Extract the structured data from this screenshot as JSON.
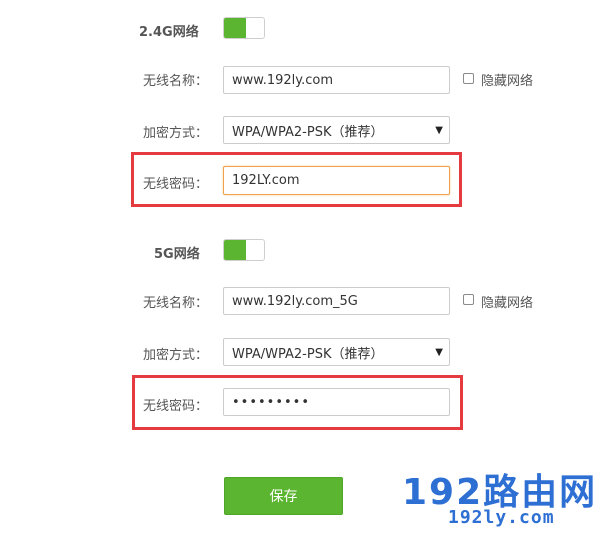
{
  "wifi_24": {
    "title": "2.4G网络",
    "ssid_label": "无线名称：",
    "ssid_value": "www.192ly.com",
    "hide_label": "隐藏网络",
    "encryption_label": "加密方式：",
    "encryption_value": "WPA/WPA2-PSK（推荐）",
    "password_label": "无线密码：",
    "password_value": "192LY.com",
    "enabled": true
  },
  "wifi_5": {
    "title": "5G网络",
    "ssid_label": "无线名称：",
    "ssid_value": "www.192ly.com_5G",
    "hide_label": "隐藏网络",
    "encryption_label": "加密方式：",
    "encryption_value": "WPA/WPA2-PSK（推荐）",
    "password_label": "无线密码：",
    "password_value": "•••••••••",
    "enabled": true
  },
  "save_label": "保存",
  "watermark": {
    "big": "192路由网",
    "small": "192ly.com"
  },
  "colors": {
    "accent_green": "#5cb531",
    "highlight_red": "#e53a40",
    "watermark_blue": "#2d6fd3",
    "focus_orange": "#f0a34b"
  },
  "icons": {
    "select_arrow": "dropdown-arrow-icon"
  }
}
